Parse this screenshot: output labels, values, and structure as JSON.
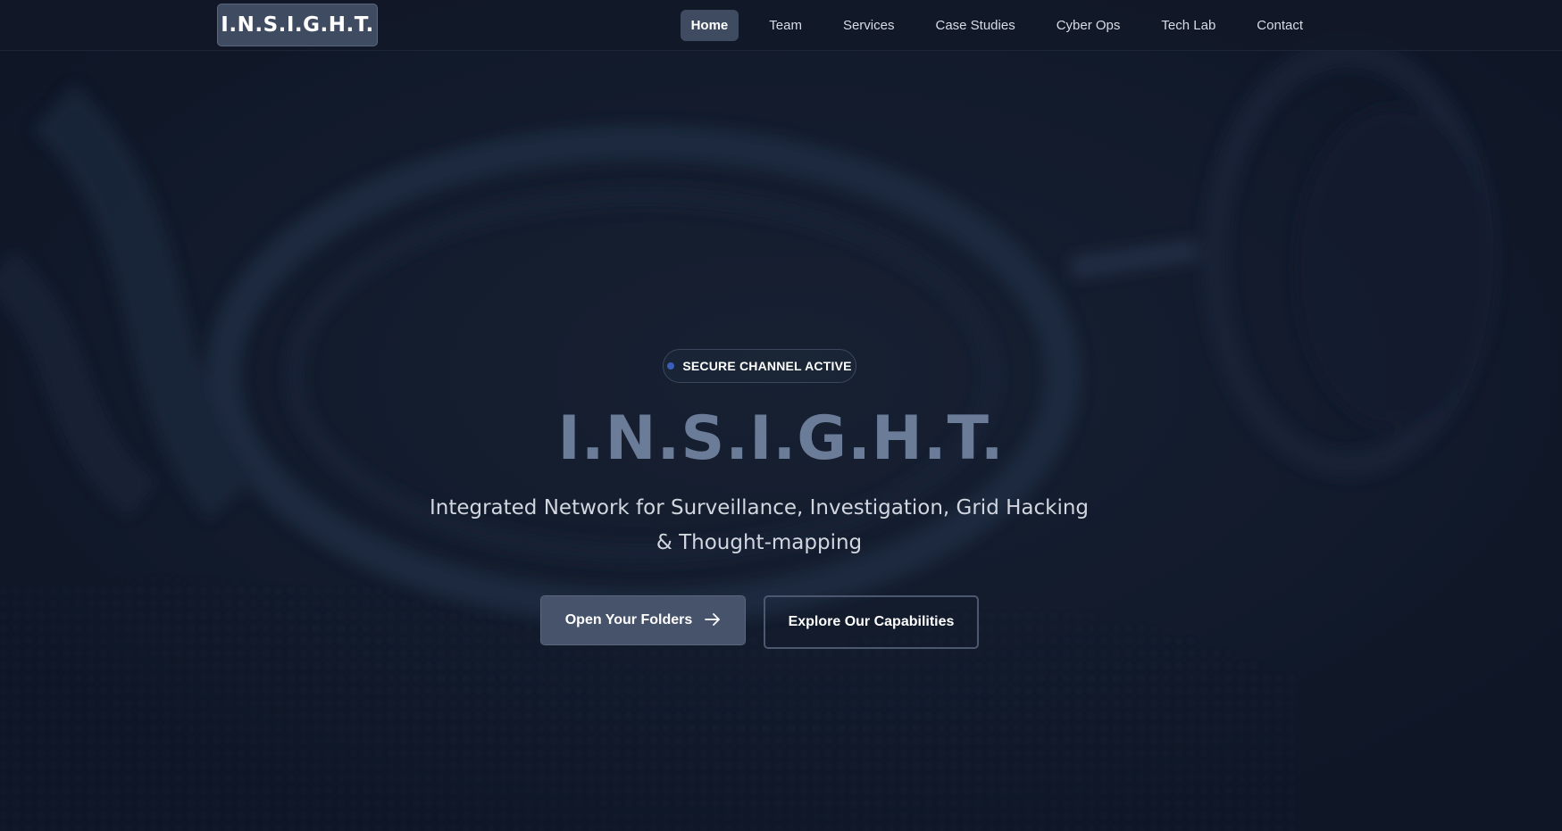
{
  "brand": {
    "logo_text": "I.N.S.I.G.H.T."
  },
  "nav": {
    "items": [
      {
        "label": "Home",
        "active": true
      },
      {
        "label": "Team",
        "active": false
      },
      {
        "label": "Services",
        "active": false
      },
      {
        "label": "Case Studies",
        "active": false
      },
      {
        "label": "Cyber Ops",
        "active": false
      },
      {
        "label": "Tech Lab",
        "active": false
      },
      {
        "label": "Contact",
        "active": false
      }
    ]
  },
  "hero": {
    "badge_text": "SECURE CHANNEL ACTIVE",
    "badge_icon": "status-dot-icon",
    "title": "I.N.S.I.G.H.T.",
    "subtitle": "Integrated Network for Surveillance, Investigation, Grid Hacking & Thought-mapping",
    "primary_button": {
      "label": "Open Your Folders",
      "icon": "arrow-right-icon"
    },
    "secondary_button": {
      "label": "Explore Our Capabilities"
    }
  },
  "colors": {
    "background": "#111a2b",
    "navbar": "#111827",
    "accent": "#3f4b60",
    "title": "#6b7c98",
    "status_dot": "#3b5fb8"
  }
}
